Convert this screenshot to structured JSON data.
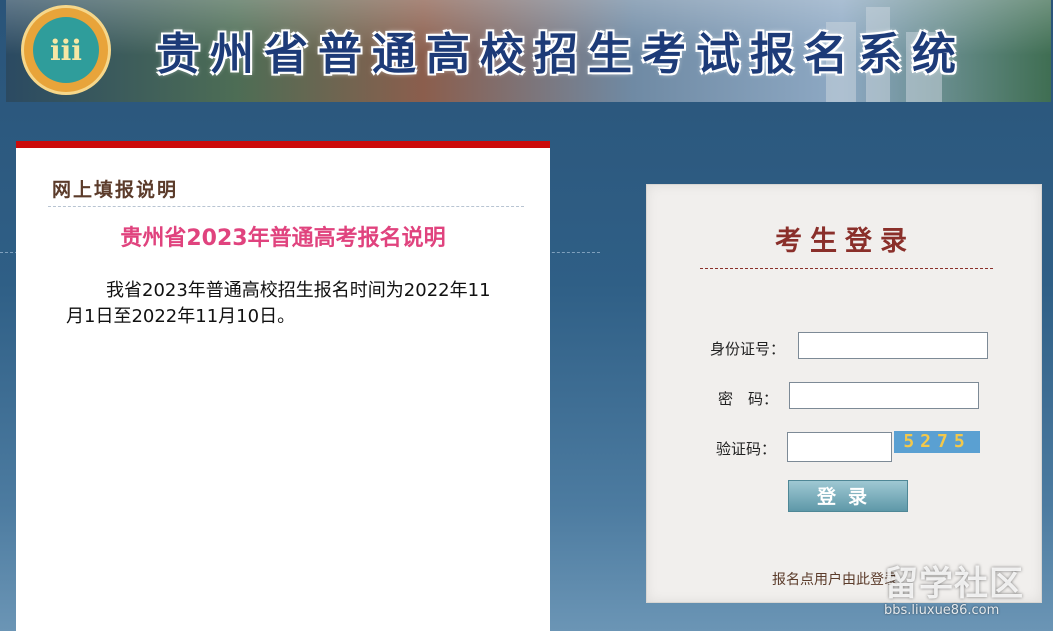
{
  "banner": {
    "title": "贵州省普通高校招生考试报名系统",
    "logo_icon": "exam-office-logo-icon"
  },
  "notice": {
    "heading": "网上填报说明",
    "title": "贵州省2023年普通高考报名说明",
    "body": "我省2023年普通高校招生报名时间为2022年11月1日至2022年11月10日。"
  },
  "login": {
    "title": "考生登录",
    "id_label": "身份证号：",
    "password_label": "密　码：",
    "captcha_label": "验证码：",
    "id_value": "",
    "password_value": "",
    "captcha_value": "",
    "captcha_image_text": "5275",
    "submit_label": "登录",
    "site_user_link": "报名点用户由此登录"
  },
  "watermark": {
    "main": "留学社区",
    "sub": "bbs.liuxue86.com"
  },
  "colors": {
    "accent_red": "#cc0b0b",
    "notice_title": "#e0437e",
    "login_title": "#8a2f2a"
  }
}
